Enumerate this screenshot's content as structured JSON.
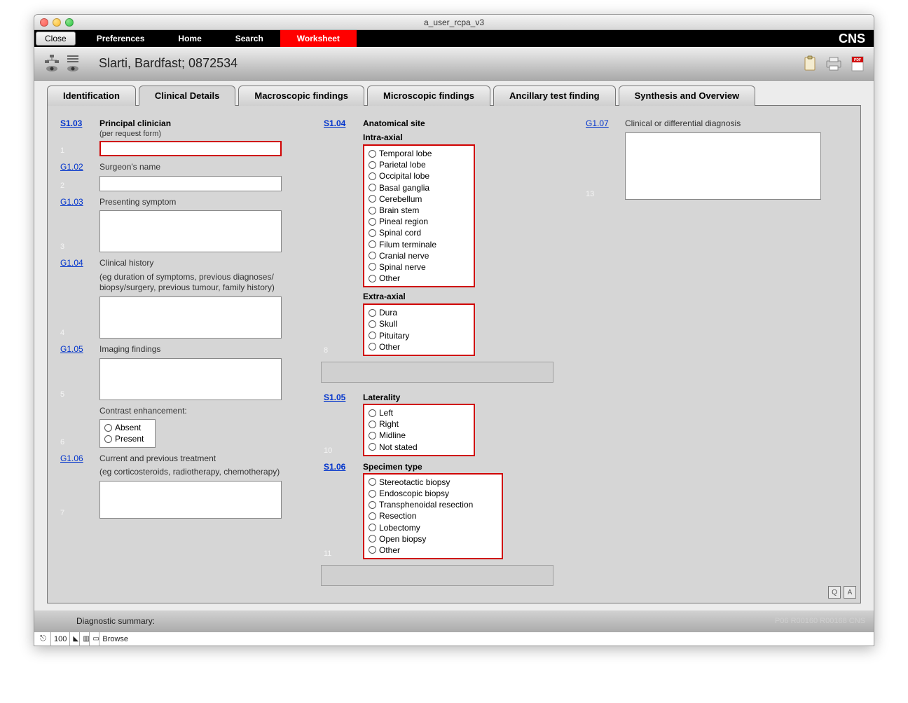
{
  "window": {
    "title": "a_user_rcpa_v3"
  },
  "menubar": {
    "close": "Close",
    "items": [
      "Preferences",
      "Home",
      "Search",
      "Worksheet"
    ],
    "product": "CNS"
  },
  "header": {
    "patient": "Slarti, Bardfast; 0872534"
  },
  "tabs": [
    {
      "label": "Identification"
    },
    {
      "label": "Clinical Details",
      "active": true
    },
    {
      "label": "Macroscopic findings"
    },
    {
      "label": "Microscopic findings"
    },
    {
      "label": "Ancillary test finding"
    },
    {
      "label": "Synthesis and Overview"
    }
  ],
  "col1": {
    "s1_03": {
      "code": "S1.03",
      "title": "Principal clinician",
      "sub": "(per request form)",
      "index": "1"
    },
    "g1_02": {
      "code": "G1.02",
      "title": "Surgeon's name",
      "index": "2"
    },
    "g1_03": {
      "code": "G1.03",
      "title": "Presenting symptom",
      "index": "3"
    },
    "g1_04": {
      "code": "G1.04",
      "title": "Clinical history",
      "help": "(eg duration of symptoms, previous diagnoses/ biopsy/surgery, previous tumour, family history)",
      "index": "4"
    },
    "g1_05": {
      "code": "G1.05",
      "title": "Imaging findings",
      "index": "5",
      "contrast_label": "Contrast enhancement:",
      "contrast_options": [
        "Absent",
        "Present"
      ],
      "contrast_index": "6"
    },
    "g1_06": {
      "code": "G1.06",
      "title": "Current and previous treatment",
      "help": "(eg corticosteroids, radiotherapy, chemotherapy)",
      "index": "7"
    }
  },
  "col2": {
    "s1_04": {
      "code": "S1.04",
      "title": "Anatomical site",
      "index": "8",
      "intra_label": "Intra-axial",
      "intra_options": [
        "Temporal lobe",
        "Parietal lobe",
        "Occipital lobe",
        "Basal ganglia",
        "Cerebellum",
        "Brain stem",
        "Pineal region",
        "Spinal cord",
        "Filum terminale",
        "Cranial nerve",
        "Spinal nerve",
        "Other"
      ],
      "extra_label": "Extra-axial",
      "extra_options": [
        "Dura",
        "Skull",
        "Pituitary",
        "Other"
      ]
    },
    "s1_05": {
      "code": "S1.05",
      "title": "Laterality",
      "index": "10",
      "options": [
        "Left",
        "Right",
        "Midline",
        "Not stated"
      ]
    },
    "s1_06": {
      "code": "S1.06",
      "title": "Specimen type",
      "index": "11",
      "options": [
        "Stereotactic biopsy",
        "Endoscopic biopsy",
        "Transphenoidal resection",
        "Resection",
        "Lobectomy",
        "Open biopsy",
        "Other"
      ]
    }
  },
  "col3": {
    "g1_07": {
      "code": "G1.07",
      "title": "Clinical or differential diagnosis",
      "index": "13"
    }
  },
  "corner": {
    "q": "Q",
    "a": "A"
  },
  "footer": {
    "label": "Diagnostic summary:",
    "meta": "P06   R00160  R00168  CNS"
  },
  "statusbar": {
    "zoom": "100",
    "mode": "Browse"
  }
}
